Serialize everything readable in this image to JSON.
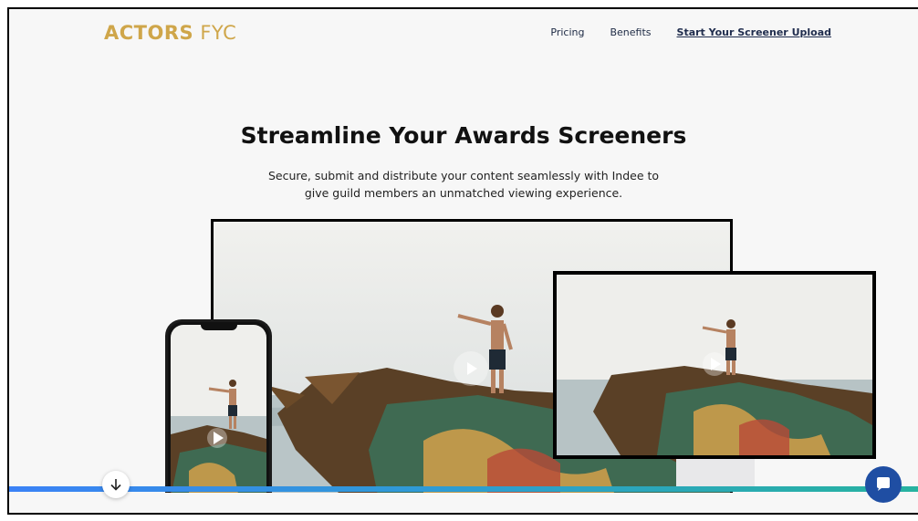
{
  "header": {
    "logo_bold": "ACTORS",
    "logo_light": "FYC",
    "nav": [
      {
        "label": "Pricing"
      },
      {
        "label": "Benefits"
      },
      {
        "label": "Start Your Screener Upload"
      }
    ]
  },
  "hero": {
    "title": "Streamline Your Awards Screeners",
    "subtitle_line1": "Secure, submit and distribute your content seamlessly with Indee to",
    "subtitle_line2": "give guild members an unmatched viewing experience."
  },
  "icons": {
    "scroll": "arrow-down-icon",
    "chat": "chat-bubble-icon",
    "play": "play-icon"
  },
  "colors": {
    "logo": "#cfa64a",
    "nav_text": "#1d2a44",
    "chat_button": "#1f4ea3",
    "progress_start": "#3b82f6",
    "progress_end": "#27b3a0"
  }
}
